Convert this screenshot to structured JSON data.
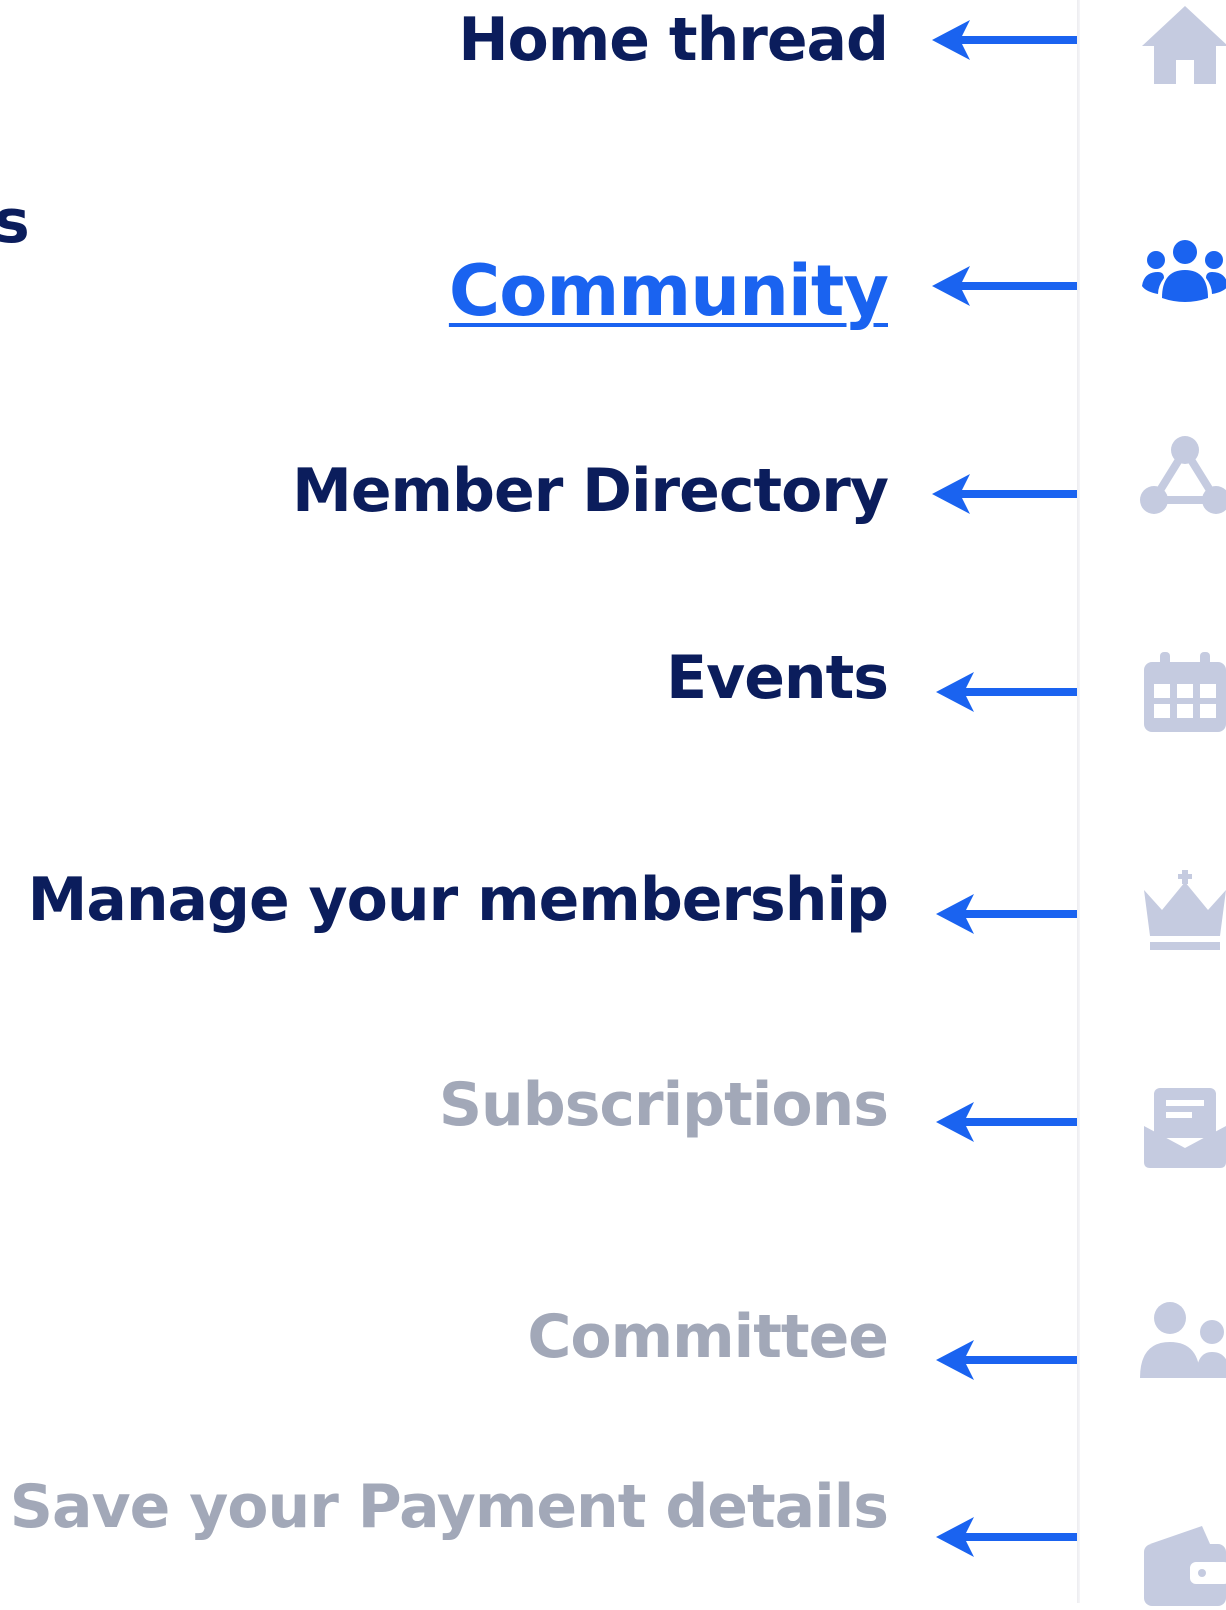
{
  "nav": {
    "cut_left_text": "s",
    "items": [
      {
        "label": "Home thread",
        "icon": "home-icon",
        "state": "normal"
      },
      {
        "label": "Community",
        "icon": "community-icon",
        "state": "active"
      },
      {
        "label": "Member Directory",
        "icon": "directory-icon",
        "state": "normal"
      },
      {
        "label": "Events",
        "icon": "calendar-icon",
        "state": "normal"
      },
      {
        "label": "Manage your membership",
        "icon": "crown-icon",
        "state": "normal"
      },
      {
        "label": "Subscriptions",
        "icon": "subscriptions-icon",
        "state": "disabled"
      },
      {
        "label": "Committee",
        "icon": "committee-icon",
        "state": "disabled"
      },
      {
        "label": "Save your Payment details",
        "icon": "wallet-icon",
        "state": "disabled"
      }
    ]
  },
  "colors": {
    "text_dark": "#0b1d5c",
    "accent": "#1a63f0",
    "muted": "#a2a8b8",
    "icon_muted": "#c5cbe0"
  }
}
